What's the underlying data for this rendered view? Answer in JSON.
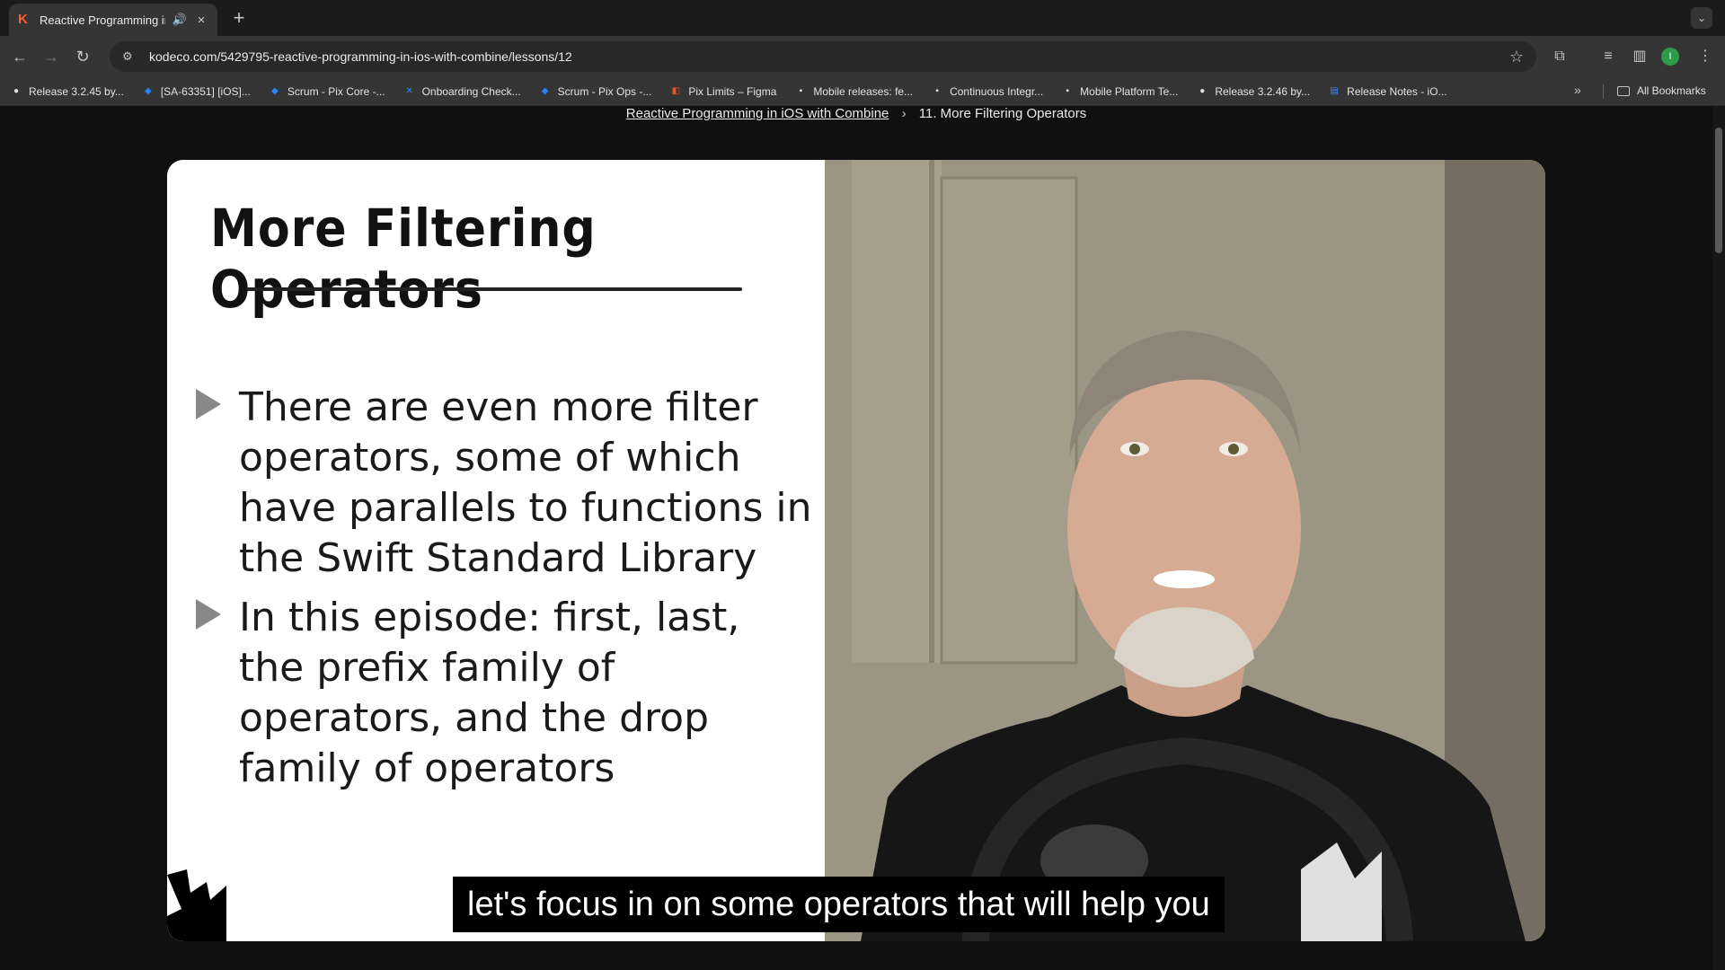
{
  "tab": {
    "title": "Reactive Programming in iOS with Combine",
    "audio_icon": "speaker-icon"
  },
  "omnibox": {
    "url": "kodeco.com/5429795-reactive-programming-in-ios-with-combine/lessons/12"
  },
  "profile": {
    "initial": "I"
  },
  "bookmarks": [
    {
      "label": "Release 3.2.45 by...",
      "icon": "github-icon",
      "color": "#e3e3e3"
    },
    {
      "label": "[SA-63351] [iOS]...",
      "icon": "jira-icon",
      "color": "#2684ff"
    },
    {
      "label": "Scrum - Pix Core -...",
      "icon": "jira-icon",
      "color": "#2684ff"
    },
    {
      "label": "Onboarding Check...",
      "icon": "confluence-icon",
      "color": "#2684ff"
    },
    {
      "label": "Scrum - Pix Ops -...",
      "icon": "jira-icon",
      "color": "#2684ff"
    },
    {
      "label": "Pix Limits – Figma",
      "icon": "figma-icon",
      "color": "#f24e1e"
    },
    {
      "label": "Mobile releases: fe...",
      "icon": "ems-icon",
      "color": "#e3e3e3"
    },
    {
      "label": "Continuous Integr...",
      "icon": "ems-icon",
      "color": "#e3e3e3"
    },
    {
      "label": "Mobile Platform Te...",
      "icon": "ems-icon",
      "color": "#e3e3e3"
    },
    {
      "label": "Release 3.2.46 by...",
      "icon": "github-icon",
      "color": "#e3e3e3"
    },
    {
      "label": "Release Notes - iO...",
      "icon": "docs-icon",
      "color": "#4285f4"
    }
  ],
  "all_bookmarks": "All Bookmarks",
  "breadcrumb": {
    "course": "Reactive Programming in iOS with Combine",
    "lesson": "11. More Filtering Operators"
  },
  "slide": {
    "title": "More Filtering Operators",
    "bullets": [
      "There are even more filter operators, some of which have parallels to functions in the Swift Standard Library",
      "In this episode: first, last, the prefix family of operators, and the drop family of operators"
    ]
  },
  "caption": "let's focus in on some operators that will help you",
  "colors": {
    "accent": "#ff5a36",
    "profile": "#2e9a4b"
  }
}
